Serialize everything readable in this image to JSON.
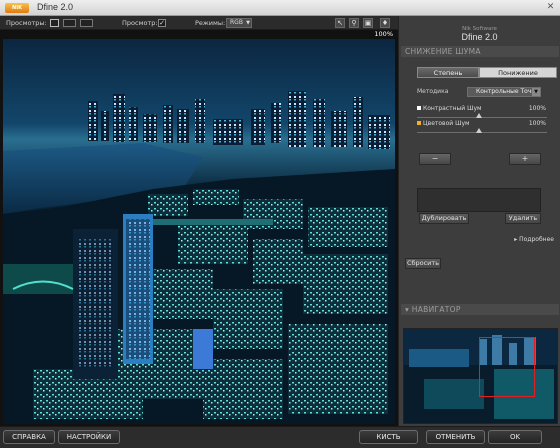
{
  "window": {
    "title": "Dfine 2.0",
    "logo_text": "NIK"
  },
  "toolbar": {
    "preview_modes_label": "Просмотры:",
    "preview_label": "Просмотр:",
    "preview_checked": "✓",
    "modes_label": "Режимы:",
    "mode_value": "RGB",
    "zoom": "100%"
  },
  "panel": {
    "brand_small": "Nik Software",
    "brand_name": "Dfine 2.0",
    "section_noise": "СНИЖЕНИЕ ШУМА",
    "tabs": [
      {
        "label": "Степень",
        "active": true
      },
      {
        "label": "Понижение",
        "active": false
      }
    ],
    "method_label": "Методика",
    "method_value": "Контрольные Точки",
    "sliders": [
      {
        "label": "Контрастный Шум",
        "value": "100%",
        "marker_color": "#ffffff"
      },
      {
        "label": "Цветовой Шум",
        "value": "100%",
        "marker_color": "#f0b020"
      }
    ],
    "minus_glyph": "−",
    "plus_glyph": "+",
    "duplicate_label": "Дублировать",
    "delete_label": "Удалить",
    "more_label": "Подробнее",
    "reset_label": "Сбросить",
    "section_navigator": "НАВИГАТОР"
  },
  "bottom": {
    "help": "СПРАВКА",
    "settings": "НАСТРОЙКИ",
    "brush": "КИСТЬ",
    "cancel": "ОТМЕНИТЬ",
    "ok": "OK"
  }
}
